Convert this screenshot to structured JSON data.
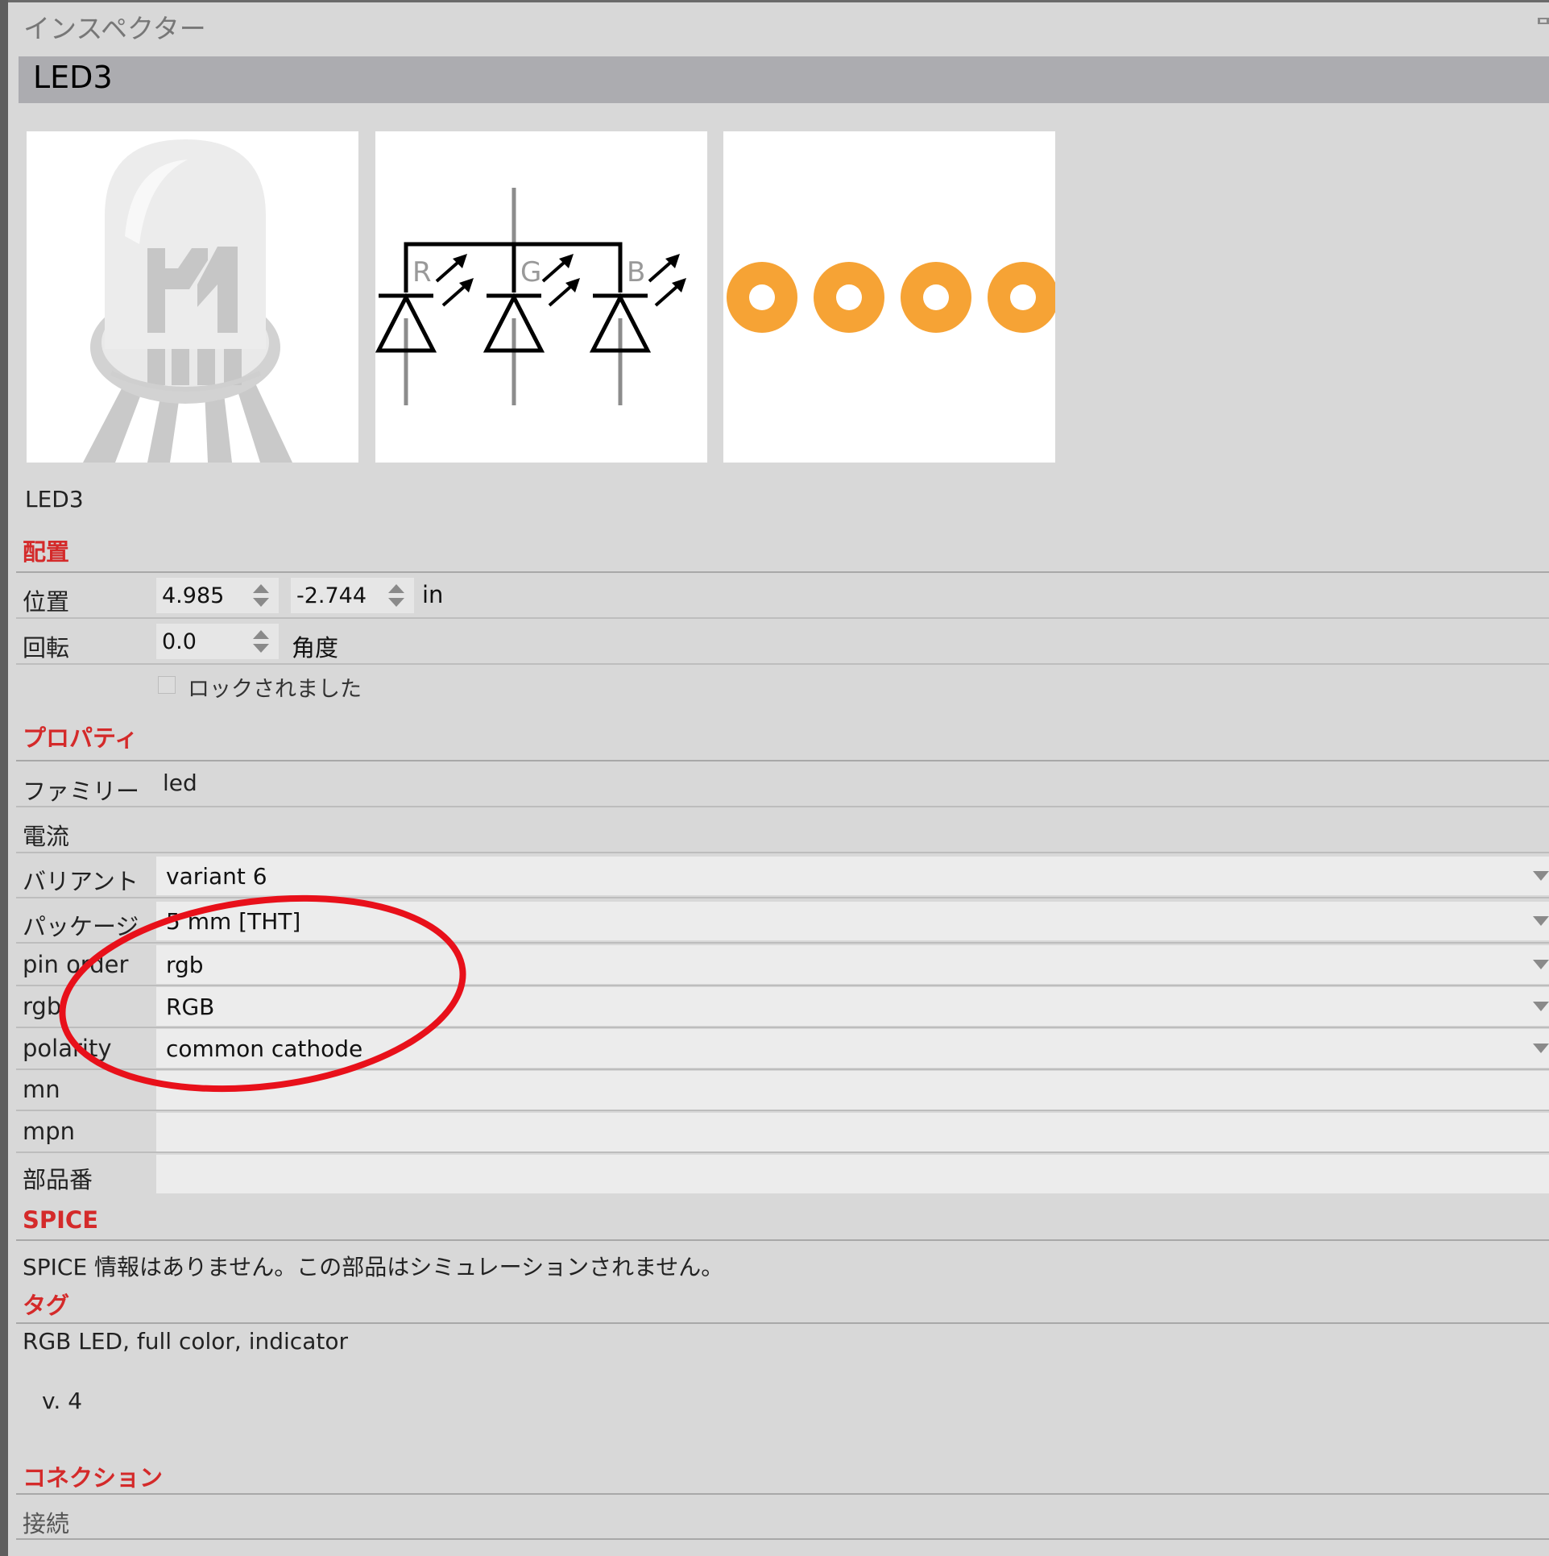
{
  "panel": {
    "title": "インスペクター"
  },
  "header": {
    "title": "LED3"
  },
  "part_name": "LED3",
  "placement": {
    "section_title": "配置",
    "position_label": "位置",
    "position_x": "4.985",
    "position_y": "-2.744",
    "position_unit": "in",
    "rotation_label": "回転",
    "rotation_value": "0.0",
    "rotation_unit": "角度",
    "locked_label": "ロックされました"
  },
  "properties": {
    "section_title": "プロパティ",
    "family_label": "ファミリー",
    "family_value": "led",
    "current_label": "電流",
    "variant_label": "バリアント",
    "variant_value": "variant 6",
    "package_label": "パッケージ",
    "package_value": "5 mm [THT]",
    "pin_order_label": "pin order",
    "pin_order_value": "rgb",
    "rgb_label": "rgb",
    "rgb_value": "RGB",
    "polarity_label": "polarity",
    "polarity_value": "common cathode",
    "mn_label": "mn",
    "mn_value": "",
    "mpn_label": "mpn",
    "mpn_value": "",
    "part_number_label": "部品番",
    "part_number_value": ""
  },
  "spice": {
    "section_title": "SPICE",
    "text": "SPICE 情報はありません。この部品はシミュレーションされません。"
  },
  "tags": {
    "section_title": "タグ",
    "text": "RGB LED, full color, indicator"
  },
  "version": "v. 4",
  "connections": {
    "section_title": "コネクション",
    "connect_label": "接続"
  },
  "schematic_labels": [
    "R",
    "G",
    "B"
  ],
  "colors": {
    "section_red": "#d42a2a",
    "pad_orange": "#f6a335",
    "annotation_red": "#e8101a",
    "header_bar": "#acacb0"
  },
  "icons": [
    "pin-icon",
    "spin-arrows-icon",
    "dropdown-caret-icon",
    "checkbox"
  ]
}
